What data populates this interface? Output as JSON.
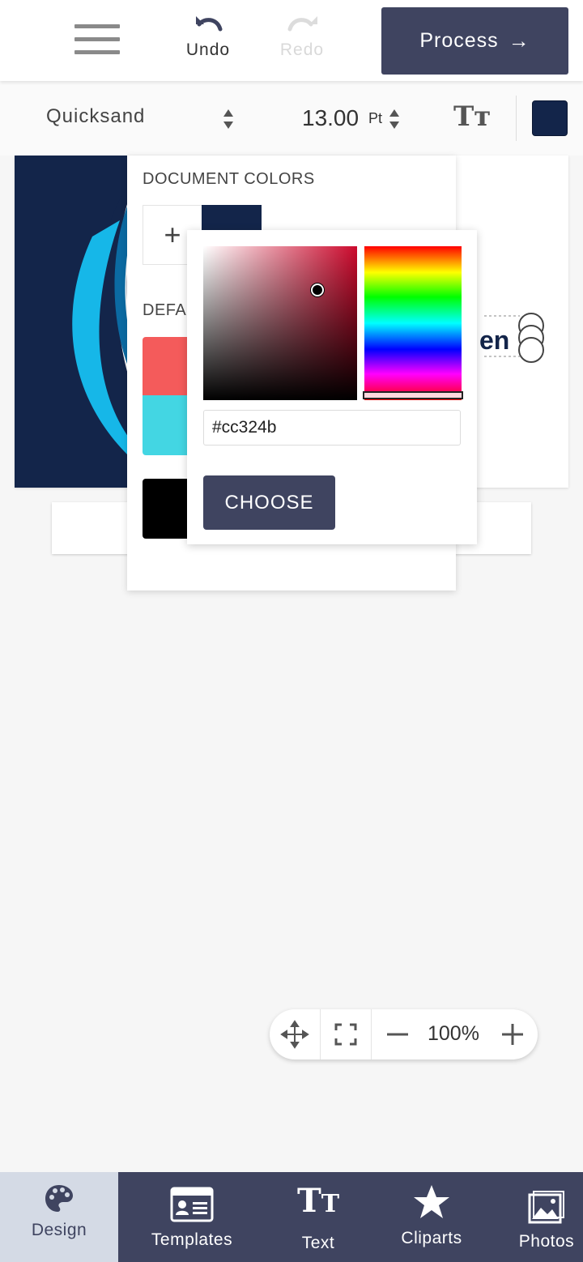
{
  "header": {
    "undo_label": "Undo",
    "redo_label": "Redo",
    "process_label": "Process",
    "process_arrow": "→"
  },
  "toolbar": {
    "font_name": "Quicksand",
    "font_size": "13.00",
    "font_size_unit": "Pt",
    "text_style_icon": "Tт",
    "current_color": "#13254a"
  },
  "canvas": {
    "visible_text": "en"
  },
  "color_panel": {
    "document_colors_title": "DOCUMENT COLORS",
    "add_label": "+",
    "document_colors": [
      "#13254a"
    ],
    "default_title": "DEFA",
    "default_colors": [
      "#f45b5b",
      "#43d6e3",
      "#000000"
    ]
  },
  "picker": {
    "hex_value": "#cc324b",
    "choose_label": "CHOOSE"
  },
  "zoom": {
    "value": "100%"
  },
  "bottom_nav": {
    "items": [
      {
        "label": "Design",
        "icon": "palette-icon",
        "active": true
      },
      {
        "label": "Templates",
        "icon": "id-card-icon",
        "active": false
      },
      {
        "label": "Text",
        "icon": "text-tt-icon",
        "active": false
      },
      {
        "label": "Cliparts",
        "icon": "star-icon",
        "active": false
      },
      {
        "label": "Photos",
        "icon": "image-icon",
        "active": false
      }
    ]
  }
}
